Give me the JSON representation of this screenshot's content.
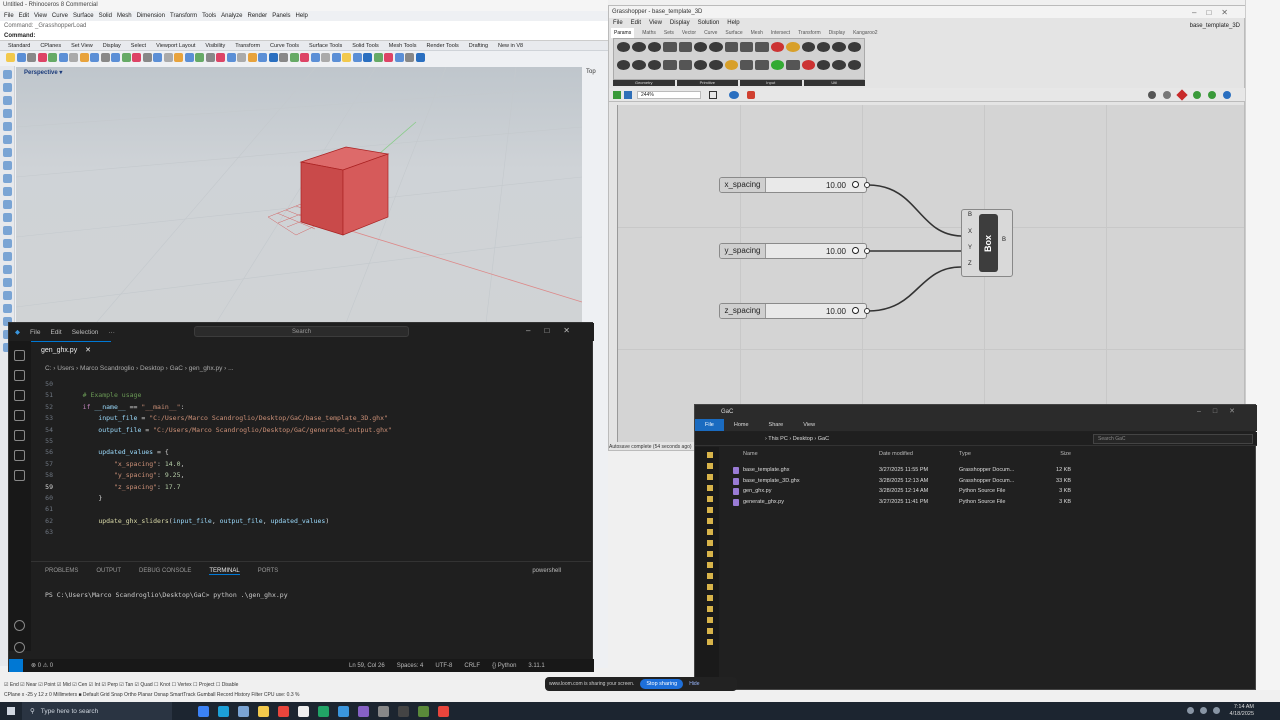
{
  "rhino": {
    "title": "Untitled - Rhinoceros 8 Commercial",
    "menu": [
      "File",
      "Edit",
      "View",
      "Curve",
      "Surface",
      "Solid",
      "Mesh",
      "Dimension",
      "Transform",
      "Tools",
      "Analyze",
      "Render",
      "Panels",
      "Help"
    ],
    "command_history": "Command: _GrasshopperLoad",
    "command_label": "Command:",
    "tabs": [
      "Standard",
      "CPlanes",
      "Set View",
      "Display",
      "Select",
      "Viewport Layout",
      "Visibility",
      "Transform",
      "Curve Tools",
      "Surface Tools",
      "Solid Tools",
      "Mesh Tools",
      "Render Tools",
      "Drafting",
      "New in V8"
    ],
    "viewport_label": "Perspective ▾",
    "top_label": "Top",
    "status_line1": "☑ End ☑ Near ☑ Point ☑ Mid ☑ Cen ☑ Int ☑ Perp ☑ Tan ☑ Quad ☐ Knot ☐ Vertex ☐ Project ☐ Disable",
    "status_line2": "CPlane   x -25  y 12  z 0   Millimeters   ■ Default   Grid Snap  Ortho  Planar  Osnap  SmartTrack  Gumball  Record History  Filter  CPU use: 0.3 %"
  },
  "grasshopper": {
    "title": "Grasshopper - base_template_3D",
    "doc_name": "base_template_3D",
    "menu": [
      "File",
      "Edit",
      "View",
      "Display",
      "Solution",
      "Help"
    ],
    "tabs": [
      "Params",
      "Maths",
      "Sets",
      "Vector",
      "Curve",
      "Surface",
      "Mesh",
      "Intersect",
      "Transform",
      "Display",
      "Kangaroo2"
    ],
    "ribbon_groups": [
      "Geometry",
      "Primitive",
      "Input",
      "Util"
    ],
    "zoom": "244%",
    "sliders": [
      {
        "name": "x_spacing",
        "value": "10.00"
      },
      {
        "name": "y_spacing",
        "value": "10.00"
      },
      {
        "name": "z_spacing",
        "value": "10.00"
      }
    ],
    "box_component": {
      "label": "Box",
      "inputs": [
        "B",
        "X",
        "Y",
        "Z"
      ],
      "output": "B"
    },
    "autosave": "Autosave complete (54 seconds ago)"
  },
  "vscode": {
    "menu": [
      "File",
      "Edit",
      "Selection",
      "···"
    ],
    "search_placeholder": "Search",
    "tab": "gen_ghx.py",
    "breadcrumb": "C: › Users › Marco Scandroglio › Desktop › GaC › gen_ghx.py › ...",
    "code_lines": [
      {
        "n": "50",
        "html": ""
      },
      {
        "n": "51",
        "html": "    <span class='cm'># Example usage</span>"
      },
      {
        "n": "52",
        "html": "    <span class='k'>if</span> __name__ <span class='p'>==</span> <span class='s'>\"__main__\"</span><span class='p'>:</span>"
      },
      {
        "n": "53",
        "html": "        input_file <span class='p'>=</span> <span class='s'>\"C:/Users/Marco Scandroglio/Desktop/GaC/base_template_3D.ghx\"</span>"
      },
      {
        "n": "54",
        "html": "        output_file <span class='p'>=</span> <span class='s'>\"C:/Users/Marco Scandroglio/Desktop/GaC/generated_output.ghx\"</span>"
      },
      {
        "n": "55",
        "html": ""
      },
      {
        "n": "56",
        "html": "        updated_values <span class='p'>= {</span>"
      },
      {
        "n": "57",
        "html": "            <span class='s'>\"x_spacing\"</span><span class='p'>:</span> <span class='nu'>14.0</span><span class='p'>,</span>"
      },
      {
        "n": "58",
        "html": "            <span class='s'>\"y_spacing\"</span><span class='p'>:</span> <span class='nu'>9.25</span><span class='p'>,</span>"
      },
      {
        "n": "59",
        "html": "            <span class='s'>\"z_spacing\"</span><span class='p'>:</span> <span class='nu'>17.7</span>"
      },
      {
        "n": "60",
        "html": "        <span class='p'>}</span>"
      },
      {
        "n": "61",
        "html": ""
      },
      {
        "n": "62",
        "html": "        <span class='f'>update_ghx_sliders</span><span class='p'>(</span>input_file<span class='p'>,</span> output_file<span class='p'>,</span> updated_values<span class='p'>)</span>"
      },
      {
        "n": "63",
        "html": ""
      }
    ],
    "current_line": "59",
    "panel_tabs": [
      "PROBLEMS",
      "OUTPUT",
      "DEBUG CONSOLE",
      "TERMINAL",
      "PORTS"
    ],
    "terminal_label": "powershell",
    "terminal_line": "PS C:\\Users\\Marco Scandroglio\\Desktop\\GaC> python .\\gen_ghx.py",
    "status": [
      "Ln 59, Col 26",
      "Spaces: 4",
      "UTF-8",
      "CRLF",
      "{} Python",
      "3.11.1"
    ],
    "errors": "⊗ 0 ⚠ 0"
  },
  "explorer": {
    "title": "GaC",
    "ribbon": [
      "File",
      "Home",
      "Share",
      "View"
    ],
    "address": "›  This PC  ›  Desktop  ›  GaC",
    "search_placeholder": "Search GaC",
    "columns": [
      "Name",
      "Date modified",
      "Type",
      "Size"
    ],
    "files": [
      {
        "name": "base_template.ghx",
        "date": "3/27/2025 11:55 PM",
        "type": "Grasshopper Docum...",
        "size": "12 KB"
      },
      {
        "name": "base_template_3D.ghx",
        "date": "3/28/2025 12:13 AM",
        "type": "Grasshopper Docum...",
        "size": "33 KB"
      },
      {
        "name": "gen_ghx.py",
        "date": "3/28/2025 12:14 AM",
        "type": "Python Source File",
        "size": "3 KB"
      },
      {
        "name": "generate_ghx.py",
        "date": "3/27/2025 11:41 PM",
        "type": "Python Source File",
        "size": "3 KB"
      }
    ]
  },
  "loom": {
    "message": "www.loom.com is sharing your screen.",
    "stop": "Stop sharing",
    "hide": "Hide"
  },
  "taskbar": {
    "search": "Type here to search",
    "time": "7:14 AM",
    "date": "4/18/2025"
  }
}
